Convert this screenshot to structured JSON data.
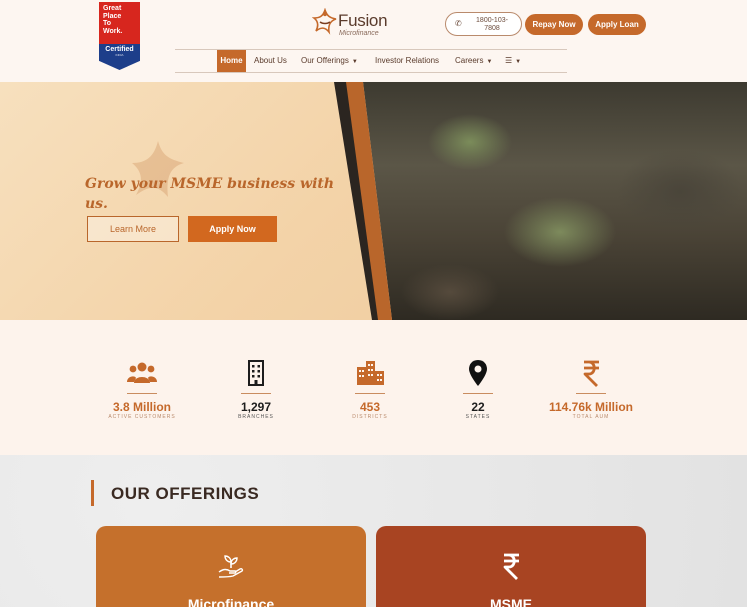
{
  "header": {
    "badge": {
      "line1": "Great",
      "line2": "Place",
      "line3": "To",
      "line4": "Work.",
      "certified": "Certified",
      "region": "INDIA"
    },
    "logo": {
      "brand": "Fusion",
      "tagline": "Microfinance"
    },
    "phone": "1800-103-7808",
    "repay_label": "Repay Now",
    "apply_loan_label": "Apply Loan",
    "nav": [
      {
        "label": "Home",
        "active": true
      },
      {
        "label": "About Us"
      },
      {
        "label": "Our Offerings",
        "dropdown": true
      },
      {
        "label": "Investor Relations"
      },
      {
        "label": "Careers",
        "dropdown": true
      },
      {
        "label": "☰",
        "dropdown": true
      }
    ]
  },
  "hero": {
    "title": "Grow your MSME business with us.",
    "learn_more": "Learn More",
    "apply_now": "Apply Now"
  },
  "stats": [
    {
      "value": "3.8 Million",
      "label": "ACTIVE CUSTOMERS",
      "icon": "people-icon"
    },
    {
      "value": "1,297",
      "label": "BRANCHES",
      "icon": "building-icon"
    },
    {
      "value": "453",
      "label": "DISTRICTS",
      "icon": "city-icon"
    },
    {
      "value": "22",
      "label": "STATES",
      "icon": "map-pin-icon"
    },
    {
      "value": "114.76k Million",
      "label": "TOTAL AUM",
      "icon": "rupee-icon"
    }
  ],
  "offerings": {
    "title": "OUR OFFERINGS",
    "cards": [
      {
        "name": "Microfinance",
        "icon": "plant-hand-icon"
      },
      {
        "name": "MSME",
        "icon": "rupee-icon"
      }
    ]
  },
  "colors": {
    "accent": "#c5692b",
    "msme_card": "#a84422",
    "hero_title": "#b9662b"
  }
}
